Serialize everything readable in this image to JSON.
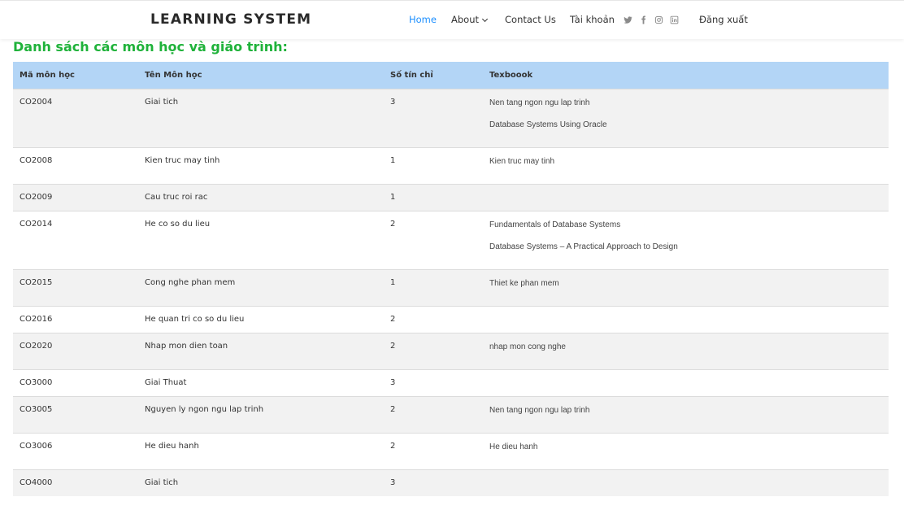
{
  "nav": {
    "brand": "LEARNING SYSTEM",
    "home": "Home",
    "about": "About",
    "contact": "Contact Us",
    "account": "Tài khoản",
    "logout": "Đăng xuất",
    "social_icons": [
      "twitter-icon",
      "facebook-icon",
      "instagram-icon",
      "linkedin-icon"
    ]
  },
  "heading": "Danh sách các môn học và giáo trình:",
  "table": {
    "headers": [
      "Mã môn học",
      "Tên Môn học",
      "Số tín chỉ",
      "Texboook"
    ],
    "rows": [
      {
        "code": "CO2004",
        "name": "Giai tich",
        "credits": "3",
        "books": [
          "Nen tang ngon ngu lap trinh",
          "Database Systems Using Oracle"
        ]
      },
      {
        "code": "CO2008",
        "name": "Kien truc may tinh",
        "credits": "1",
        "books": [
          "Kien truc may tinh"
        ]
      },
      {
        "code": "CO2009",
        "name": "Cau truc roi rac",
        "credits": "1",
        "books": []
      },
      {
        "code": "CO2014",
        "name": "He co so du lieu",
        "credits": "2",
        "books": [
          "Fundamentals of Database Systems",
          "Database Systems – A Practical Approach to Design"
        ]
      },
      {
        "code": "CO2015",
        "name": "Cong nghe phan mem",
        "credits": "1",
        "books": [
          "Thiet ke phan mem"
        ]
      },
      {
        "code": "CO2016",
        "name": "He quan tri co so du lieu",
        "credits": "2",
        "books": []
      },
      {
        "code": "CO2020",
        "name": "Nhap mon dien toan",
        "credits": "2",
        "books": [
          "nhap mon cong nghe"
        ]
      },
      {
        "code": "CO3000",
        "name": "Giai Thuat",
        "credits": "3",
        "books": []
      },
      {
        "code": "CO3005",
        "name": "Nguyen ly ngon ngu lap trinh",
        "credits": "2",
        "books": [
          "Nen tang ngon ngu lap trinh"
        ]
      },
      {
        "code": "CO3006",
        "name": "He dieu hanh",
        "credits": "2",
        "books": [
          "He dieu hanh"
        ]
      },
      {
        "code": "CO4000",
        "name": "Giai tich",
        "credits": "3",
        "books": []
      }
    ]
  },
  "colors": {
    "accent": "#1e90ff",
    "heading": "#1fb23a",
    "table_header_bg": "#b3d5f6",
    "row_alt_bg": "#f2f2f2"
  }
}
